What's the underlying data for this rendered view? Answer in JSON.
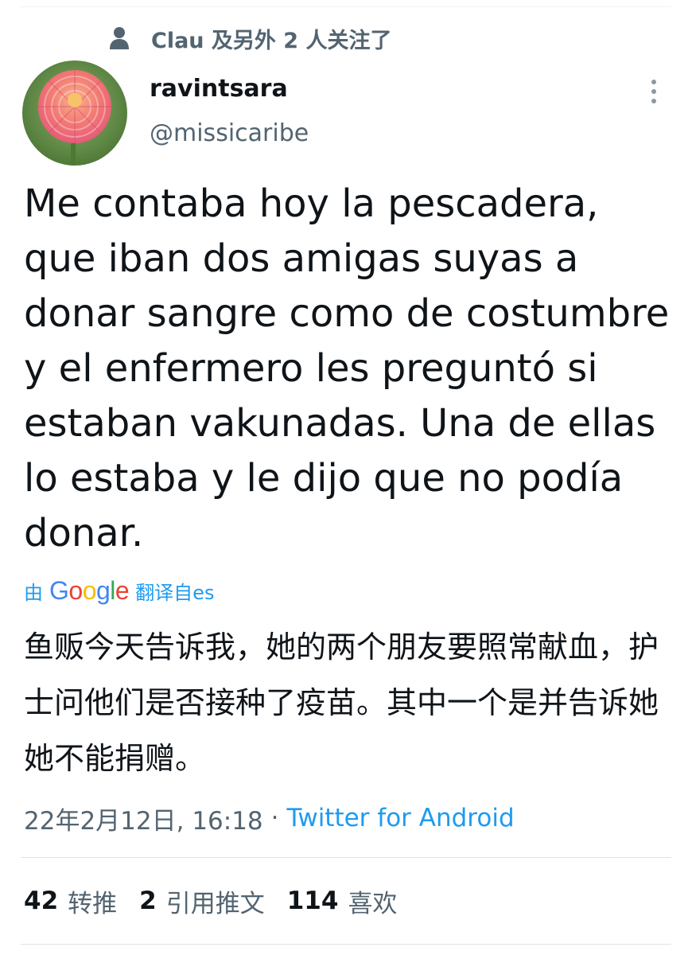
{
  "social_context": {
    "icon": "person-icon",
    "text": "Clau 及另外 2 人关注了"
  },
  "author": {
    "avatar": "dahlia-flower-avatar",
    "display_name": "ravintsara",
    "handle": "@missicaribe"
  },
  "tweet": {
    "text": "Me contaba hoy la pescadera,\nque iban dos amigas suyas a\ndonar sangre como de costumbre\ny el enfermero les preguntó si\nestaban vakunadas. Una de ellas\nlo estaba y le dijo que no podía\ndonar.",
    "translation": {
      "prefix": "由",
      "provider": "Google",
      "suffix": "翻译自es",
      "text": "鱼贩今天告诉我，她的两个朋友要照常献血，护士问他们是否接种了疫苗。其中一个是并告诉她她不能捐赠。"
    },
    "timestamp": "22年2月12日, 16:18",
    "separator": "·",
    "source": "Twitter for Android"
  },
  "stats": {
    "retweets": {
      "count": "42",
      "label": "转推"
    },
    "quotes": {
      "count": "2",
      "label": "引用推文"
    },
    "likes": {
      "count": "114",
      "label": "喜欢"
    }
  },
  "colors": {
    "link": "#1d9bf0",
    "secondary_text": "#536471",
    "primary_text": "#0f1419"
  }
}
